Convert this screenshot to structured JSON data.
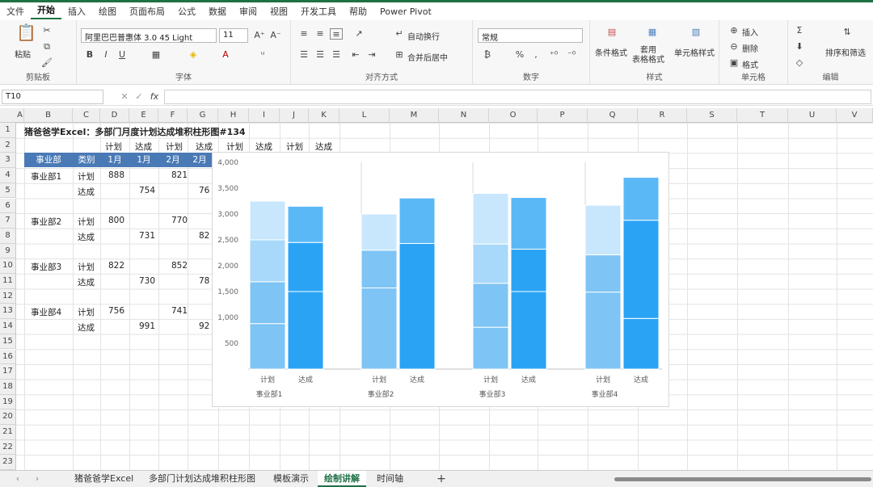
{
  "menu": [
    "文件",
    "开始",
    "插入",
    "绘图",
    "页面布局",
    "公式",
    "数据",
    "审阅",
    "视图",
    "开发工具",
    "帮助",
    "Power Pivot"
  ],
  "ribbon": {
    "paste": "粘贴",
    "clipboard": "剪贴板",
    "font_name": "阿里巴巴普惠体 3.0 45 Light",
    "font_size": "11",
    "font_group": "字体",
    "wrap": "自动换行",
    "merge": "合并后居中",
    "align_group": "对齐方式",
    "number_format": "常规",
    "number_group": "数字",
    "cond_format": "条件格式",
    "table_format": "套用\n表格格式",
    "cell_style": "单元格样式",
    "styles_group": "样式",
    "insert": "插入",
    "delete": "删除",
    "format": "格式",
    "cells_group": "单元格",
    "sort_filter": "排序和筛选",
    "editing_group": "编辑"
  },
  "formula": {
    "namebox": "T10",
    "fx": "fx"
  },
  "columns": [
    "A",
    "B",
    "C",
    "D",
    "E",
    "F",
    "G",
    "H",
    "I",
    "J",
    "K",
    "L",
    "M",
    "N",
    "O",
    "P",
    "Q",
    "R",
    "S",
    "T",
    "U",
    "V"
  ],
  "rows": [
    "1",
    "2",
    "3",
    "4",
    "5",
    "6",
    "7",
    "8",
    "9",
    "10",
    "11",
    "12",
    "13",
    "14",
    "15",
    "16",
    "17",
    "18",
    "19",
    "20",
    "21",
    "22",
    "23"
  ],
  "sheet": {
    "title": "猪爸爸学Excel：多部门月度计划达成堆积柱形图#134",
    "row2": [
      "计划",
      "达成",
      "计划",
      "达成",
      "计划",
      "达成",
      "计划",
      "达成"
    ],
    "row3": [
      "事业部",
      "类别",
      "1月",
      "1月",
      "2月",
      "2月"
    ],
    "depts": [
      "事业部1",
      "事业部2",
      "事业部3",
      "事业部4"
    ],
    "plan_label": "计划",
    "actual_label": "达成",
    "plan_jan": [
      "888",
      "800",
      "822",
      "756"
    ],
    "actual_jan": [
      "754",
      "731",
      "730",
      "991"
    ],
    "plan_feb": [
      "821",
      "770",
      "852",
      "741"
    ],
    "actual_feb": [
      "76",
      "82",
      "78",
      "92"
    ]
  },
  "chart_data": {
    "type": "bar",
    "stacked": true,
    "ylim": [
      0,
      4000
    ],
    "yticks": [
      "4,000",
      "3,500",
      "3,000",
      "2,500",
      "2,000",
      "1,500",
      "1,000",
      "500"
    ],
    "groups": [
      {
        "name": "事业部1",
        "bars": [
          {
            "label": "计划",
            "segments": [
              880,
              810,
              810,
              750
            ]
          },
          {
            "label": "达成",
            "segments": [
              1500,
              950,
              700
            ]
          }
        ]
      },
      {
        "name": "事业部2",
        "bars": [
          {
            "label": "计划",
            "segments": [
              1570,
              730,
              700
            ]
          },
          {
            "label": "达成",
            "segments": [
              2430,
              880
            ]
          }
        ]
      },
      {
        "name": "事业部3",
        "bars": [
          {
            "label": "计划",
            "segments": [
              810,
              850,
              760,
              980
            ]
          },
          {
            "label": "达成",
            "segments": [
              1500,
              820,
              1000
            ]
          }
        ]
      },
      {
        "name": "事业部4",
        "bars": [
          {
            "label": "计划",
            "segments": [
              1490,
              720,
              960
            ]
          },
          {
            "label": "达成",
            "segments": [
              980,
              1900,
              830
            ]
          }
        ]
      }
    ],
    "colors": [
      "#7ec4f5",
      "#a8d8fa",
      "#c9e7fc",
      "#2aa3f5",
      "#5bb8f7"
    ]
  },
  "tabs": [
    "猪爸爸学Excel",
    "多部门计划达成堆积柱形图",
    "模板演示",
    "绘制讲解",
    "时间轴"
  ],
  "active_tab": "绘制讲解"
}
